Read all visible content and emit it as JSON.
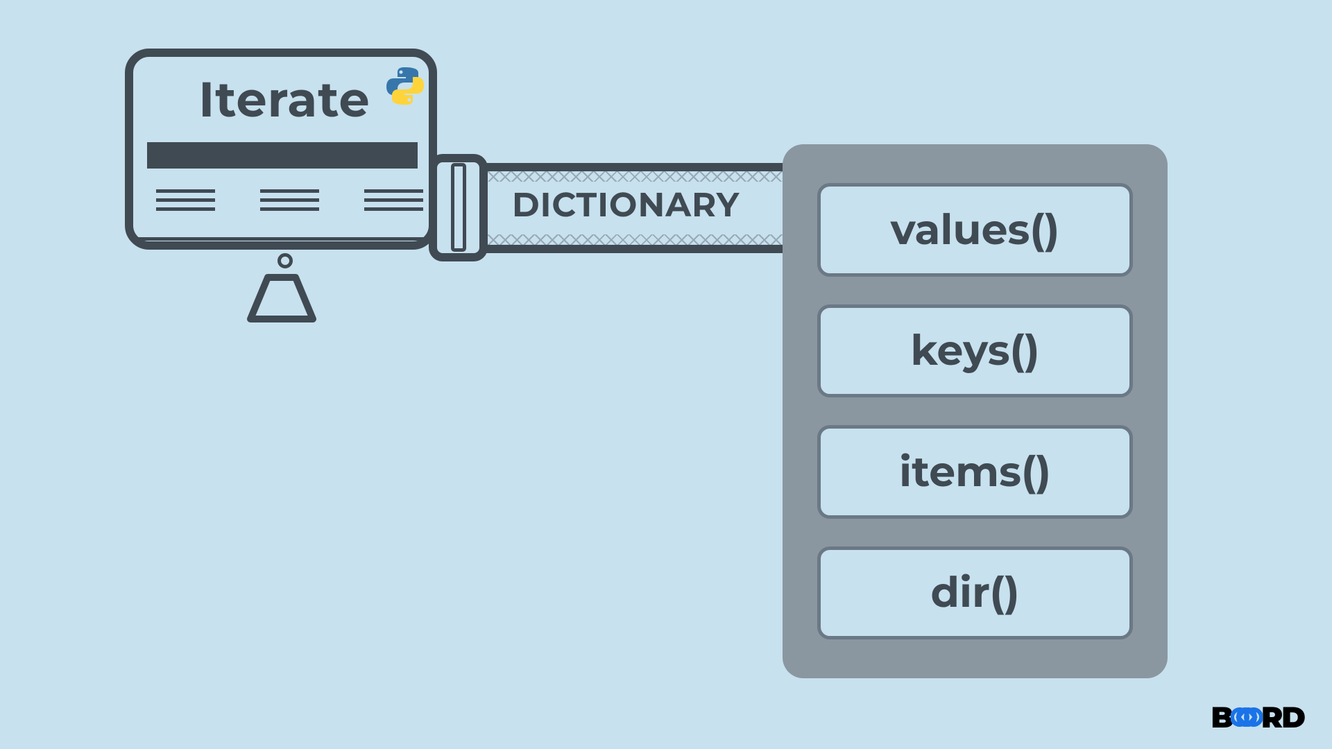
{
  "monitor": {
    "title": "Iterate"
  },
  "tube": {
    "label": "DICTIONARY"
  },
  "methods": {
    "items": [
      {
        "label": "values()"
      },
      {
        "label": "keys()"
      },
      {
        "label": "items()"
      },
      {
        "label": "dir()"
      }
    ]
  },
  "logo": {
    "part1": "B",
    "part2": "∞",
    "part3": "RD"
  }
}
